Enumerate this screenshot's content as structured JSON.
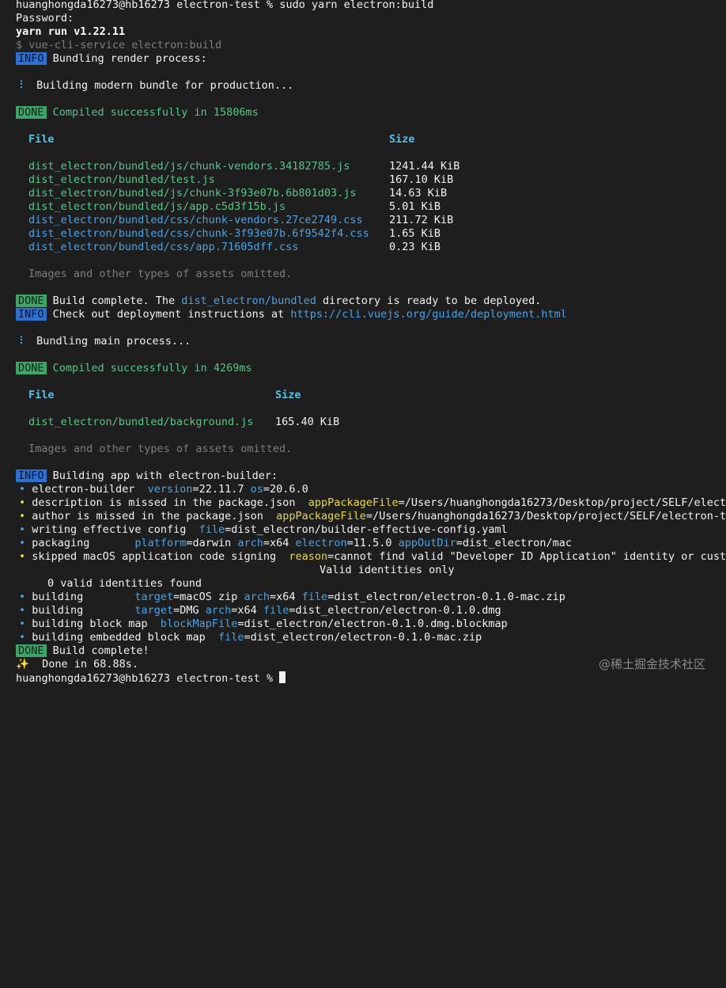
{
  "prompt": {
    "user_host": "huanghongda16273@hb16273",
    "dir": "electron-test",
    "symbol": "%",
    "command": "sudo yarn electron:build"
  },
  "password_line": "Password:",
  "yarn_run": "yarn run v1.22.11",
  "vue_cli": "$ vue-cli-service electron:build",
  "badges": {
    "info": "INFO",
    "done": "DONE"
  },
  "render": {
    "bundling": "Bundling render process:",
    "spinner": "⠸",
    "building": "Building modern bundle for production...",
    "compiled": "Compiled successfully in 15806ms",
    "file_header": "File",
    "size_header": "Size",
    "files": [
      {
        "name": "dist_electron/bundled/js/chunk-vendors.34182785.js",
        "size": "1241.44 KiB",
        "kind": "js"
      },
      {
        "name": "dist_electron/bundled/test.js",
        "size": "167.10 KiB",
        "kind": "js"
      },
      {
        "name": "dist_electron/bundled/js/chunk-3f93e07b.6b801d03.js",
        "size": "14.63 KiB",
        "kind": "js"
      },
      {
        "name": "dist_electron/bundled/js/app.c5d3f15b.js",
        "size": "5.01 KiB",
        "kind": "js"
      },
      {
        "name": "dist_electron/bundled/css/chunk-vendors.27ce2749.css",
        "size": "211.72 KiB",
        "kind": "css"
      },
      {
        "name": "dist_electron/bundled/css/chunk-3f93e07b.6f9542f4.css",
        "size": "1.65 KiB",
        "kind": "css"
      },
      {
        "name": "dist_electron/bundled/css/app.71605dff.css",
        "size": "0.23 KiB",
        "kind": "css"
      }
    ],
    "omitted": "Images and other types of assets omitted.",
    "build_complete_pre": "Build complete. The ",
    "build_complete_dir": "dist_electron/bundled",
    "build_complete_post": " directory is ready to be deployed.",
    "check_out_pre": "Check out deployment instructions at ",
    "check_out_url": "https://cli.vuejs.org/guide/deployment.html"
  },
  "main": {
    "bundling": "Bundling main process...",
    "compiled": "Compiled successfully in 4269ms",
    "file_header": "File",
    "size_header": "Size",
    "file": "dist_electron/bundled/background.js",
    "size": "165.40 KiB",
    "omitted": "Images and other types of assets omitted."
  },
  "builder": {
    "building_app": "Building app with electron-builder:",
    "bullet": "•",
    "l1_text": "electron-builder  ",
    "l1_k1": "version",
    "l1_v1": "=22.11.7 ",
    "l1_k2": "os",
    "l1_v2": "=20.6.0",
    "l2_text": "description is missed in the package.json  ",
    "l2_k": "appPackageFile",
    "l2_v": "=/Users/huanghongda16273/Desktop/project/SELF/elect",
    "l3_text": "author is missed in the package.json  ",
    "l3_k": "appPackageFile",
    "l3_v": "=/Users/huanghongda16273/Desktop/project/SELF/electron-te",
    "l4_text": "writing effective config  ",
    "l4_k": "file",
    "l4_v": "=dist_electron/builder-effective-config.yaml",
    "l5_text": "packaging       ",
    "l5_k1": "platform",
    "l5_v1": "=darwin ",
    "l5_k2": "arch",
    "l5_v2": "=x64 ",
    "l5_k3": "electron",
    "l5_v3": "=11.5.0 ",
    "l5_k4": "appOutDir",
    "l5_v4": "=dist_electron/mac",
    "l6_text": "skipped macOS application code signing  ",
    "l6_k": "reason",
    "l6_v": "=cannot find valid \"Developer ID Application\" identity or custo",
    "l6_cont": "Valid identities only",
    "identities": "0 valid identities found",
    "l7_text": "building        ",
    "l7_k1": "target",
    "l7_v1": "=macOS zip ",
    "l7_k2": "arch",
    "l7_v2": "=x64 ",
    "l7_k3": "file",
    "l7_v3": "=dist_electron/electron-0.1.0-mac.zip",
    "l8_text": "building        ",
    "l8_k1": "target",
    "l8_v1": "=DMG ",
    "l8_k2": "arch",
    "l8_v2": "=x64 ",
    "l8_k3": "file",
    "l8_v3": "=dist_electron/electron-0.1.0.dmg",
    "l9_text": "building block map  ",
    "l9_k": "blockMapFile",
    "l9_v": "=dist_electron/electron-0.1.0.dmg.blockmap",
    "l10_text": "building embedded block map  ",
    "l10_k": "file",
    "l10_v": "=dist_electron/electron-0.1.0-mac.zip",
    "complete": "Build complete!",
    "sparkle": "✨",
    "done": "Done in 68.88s."
  },
  "watermark": "@稀土掘金技术社区"
}
